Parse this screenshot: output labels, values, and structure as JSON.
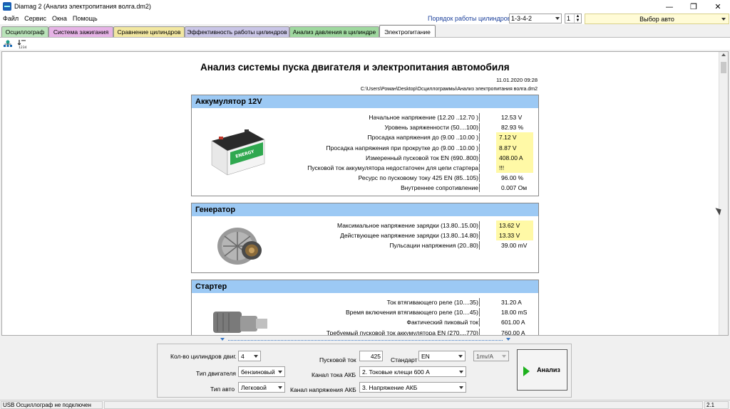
{
  "window": {
    "title": "Diamag 2 (Анализ электропитания волга.dm2)",
    "minimize": "—",
    "restore": "❐",
    "close": "✕"
  },
  "menu": [
    "Файл",
    "Сервис",
    "Окна",
    "Помощь"
  ],
  "cylinder_order": {
    "label": "Порядок работы цилиндров",
    "value": "1-3-4-2",
    "spin_value": "1"
  },
  "car_select": "Выбор авто",
  "tabs": [
    {
      "label": "Осциллограф",
      "color": "#b9e3b9"
    },
    {
      "label": "Система зажигания",
      "color": "#e6b3e6"
    },
    {
      "label": "Сравнение цилиндров",
      "color": "#f2e7a1"
    },
    {
      "label": "Эффективность работы цилиндров",
      "color": "#c9c5e6"
    },
    {
      "label": "Анализ давления в цилиндре",
      "color": "#9fd89f"
    },
    {
      "label": "Электропитание",
      "color": "#ffffff"
    }
  ],
  "report": {
    "title": "Анализ системы пуска двигателя и электропитания автомобиля",
    "date": "11.01.2020 09:28",
    "path": "C:\\Users\\Роман\\Desktop\\Осциллограммы\\Анализ электропитания волга.dm2",
    "sections": [
      {
        "title": "Аккумулятор 12V",
        "rows": [
          {
            "label": "Начальное напряжение (12.20 ..12.70 )",
            "value": "12.53 V",
            "highlight": false
          },
          {
            "label": "Уровень заряженности (50....100)",
            "value": "82.93 %",
            "highlight": false
          },
          {
            "label": "Просадка напряжения до (9.00 ..10.00 )",
            "value": "7.12 V",
            "highlight": true
          },
          {
            "label": "Просадка напряжения при прокрутке до (9.00 ..10.00 )",
            "value": "8.87 V",
            "highlight": true
          },
          {
            "label": "Измеренный пусковой ток  EN (690..800)",
            "value": "408.00 A",
            "highlight": true
          },
          {
            "label": "Пусковой ток аккумулятора недостаточен для цепи стартера",
            "value": "!!!",
            "highlight": true
          },
          {
            "label": "Ресурс по пусковому току  425 EN (85..105)",
            "value": "96.00 %",
            "highlight": false
          },
          {
            "label": "Внутреннее сопротивление",
            "value": "0.007 Ом",
            "highlight": false
          }
        ]
      },
      {
        "title": "Генератор",
        "rows": [
          {
            "label": "Максимальное напряжение зарядки  (13.80..15.00)",
            "value": "13.62 V",
            "highlight": true
          },
          {
            "label": "Действующее напряжение зарядки (13.80..14.80)",
            "value": "13.33 V",
            "highlight": true
          },
          {
            "label": "Пульсации напряжения (20..80)",
            "value": "39.00 mV",
            "highlight": false
          }
        ]
      },
      {
        "title": "Стартер",
        "rows": [
          {
            "label": "Ток втягивающего реле (10....35)",
            "value": "31.20 A",
            "highlight": false
          },
          {
            "label": "Время включения втягивающего реле (10....45)",
            "value": "18.00 mS",
            "highlight": false
          },
          {
            "label": "Фактический пиковый ток",
            "value": "601.00 A",
            "highlight": false
          },
          {
            "label": "Требуемый пусковой ток аккумулятора  EN (270....770)",
            "value": "760.00 A",
            "highlight": false
          }
        ]
      }
    ]
  },
  "battery_label": "ENERGY",
  "controls": {
    "cyl_count_label": "Кол-во цилиндров двиг.",
    "cyl_count_value": "4",
    "engine_type_label": "Тип двигателя",
    "engine_type_value": "бензиновый",
    "car_type_label": "Тип авто",
    "car_type_value": "Легковой",
    "start_current_label": "Пусковой ток",
    "start_current_value": "425",
    "standard_label": "Стандарт",
    "standard_value": "EN",
    "current_channel_label": "Канал тока АКБ",
    "current_channel_value": "2. Токовые клещи 600 А",
    "voltage_channel_label": "Канал напряжения АКБ",
    "voltage_channel_value": "3. Напряжение АКБ",
    "scale_value": "1mv/A",
    "analyze_label": "Анализ"
  },
  "status": {
    "left": "USB Осциллограф не подключен",
    "right": "2.1"
  }
}
